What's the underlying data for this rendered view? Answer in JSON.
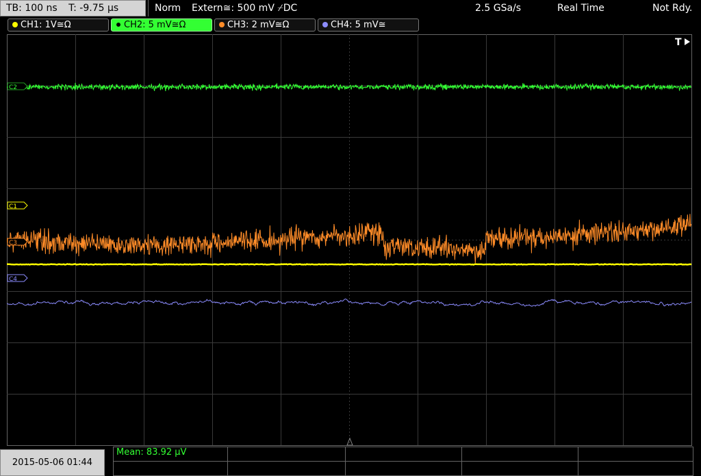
{
  "topbar": {
    "timebase": "TB: 100 ns",
    "trigger_time": "T: -9.75 µs",
    "acq_mode": "Norm",
    "trigger_source": "Extern≅: 500 mV ⌿DC",
    "sample_rate": "2.5 GSa/s",
    "realtime": "Real Time",
    "status": "Not Rdy."
  },
  "channels": [
    {
      "label": "CH1: 1V≅Ω",
      "color": "#ffff00"
    },
    {
      "label": "CH2: 5 mV≅Ω",
      "color": "#33ff33"
    },
    {
      "label": "CH3: 2 mV≅Ω",
      "color": "#ff8c28"
    },
    {
      "label": "CH4: 5 mV≅",
      "color": "#8c8cff"
    }
  ],
  "markers": {
    "c1": "C1",
    "c2": "C2",
    "c3": "C3",
    "c4": "C4",
    "trigger": "T"
  },
  "bottombar": {
    "datetime": "2015-05-06 01:44",
    "measurement": "Mean: 83.92 µV"
  }
}
